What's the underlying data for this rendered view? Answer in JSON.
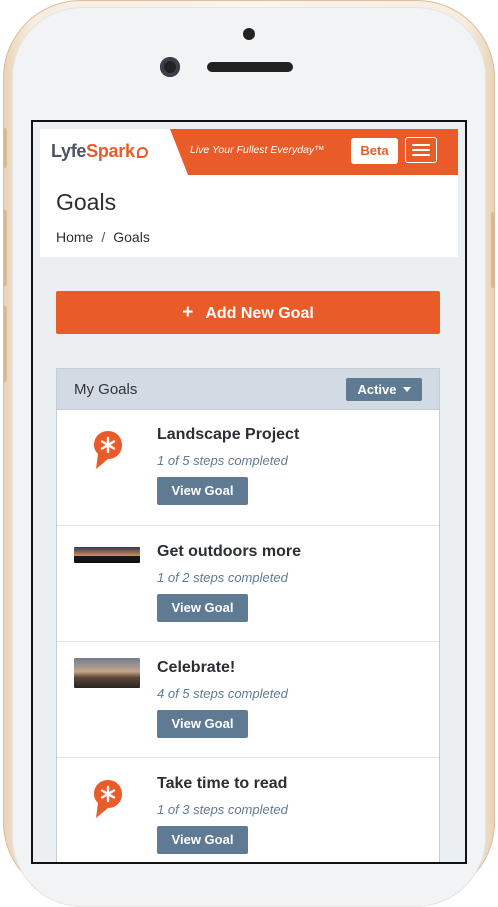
{
  "brand": {
    "part1": "Lyfe",
    "part2": "Spark"
  },
  "tagline": "Live Your Fullest Everyday™",
  "beta_label": "Beta",
  "page": {
    "title": "Goals"
  },
  "breadcrumb": {
    "home": "Home",
    "separator": "/",
    "current": "Goals"
  },
  "add_button": {
    "icon": "+",
    "label": "Add New Goal"
  },
  "goals_card": {
    "title": "My Goals",
    "filter_label": "Active",
    "goals": [
      {
        "name": "Landscape Project",
        "progress": "1 of 5 steps completed",
        "button": "View Goal",
        "image": "spark-logo-icon"
      },
      {
        "name": "Get outdoors more",
        "progress": "1 of 2 steps completed",
        "button": "View Goal",
        "image": "sunset-photo"
      },
      {
        "name": "Celebrate!",
        "progress": "4 of 5 steps completed",
        "button": "View Goal",
        "image": "celebration-photo"
      },
      {
        "name": "Take time to read",
        "progress": "1 of 3 steps completed",
        "button": "View Goal",
        "image": "spark-logo-icon"
      }
    ]
  },
  "colors": {
    "accent": "#e95c29",
    "slate": "#5f7b93",
    "header_bg": "#d2dbe4"
  }
}
